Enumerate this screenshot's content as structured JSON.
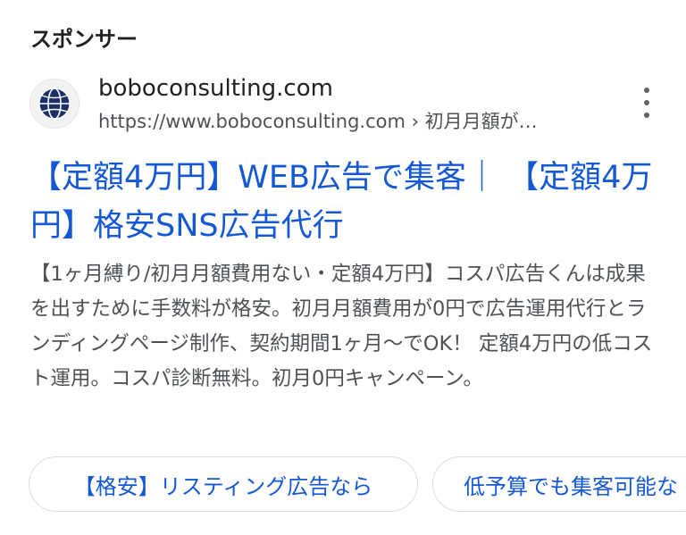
{
  "sponsored_label": "スポンサー",
  "ad": {
    "site_name": "boboconsulting.com",
    "url": "https://www.boboconsulting.com › 初月月額が…",
    "favicon": "globe-icon",
    "headline": "【定額4万円】WEB広告で集客｜ 【定額4万円】格安SNS広告代行",
    "description": "【1ヶ月縛り/初月月額費用ない・定額4万円】コスパ広告くんは成果を出すために手数料が格安。初月月額費用が0円で広告運用代行とランディングページ制作、契約期間1ヶ月〜でOK！ 定額4万円の低コスト運用。コスパ診断無料。初月0円キャンペーン。",
    "menu_icon": "more-vert-icon"
  },
  "sitelinks": [
    {
      "label": "【格安】リスティング広告なら"
    },
    {
      "label": "低予算でも集客可能な"
    }
  ],
  "colors": {
    "link_blue": "#1558d6",
    "text_dark": "#202124",
    "text_grey": "#4d5156",
    "favicon_navy": "#1c2f6b"
  }
}
